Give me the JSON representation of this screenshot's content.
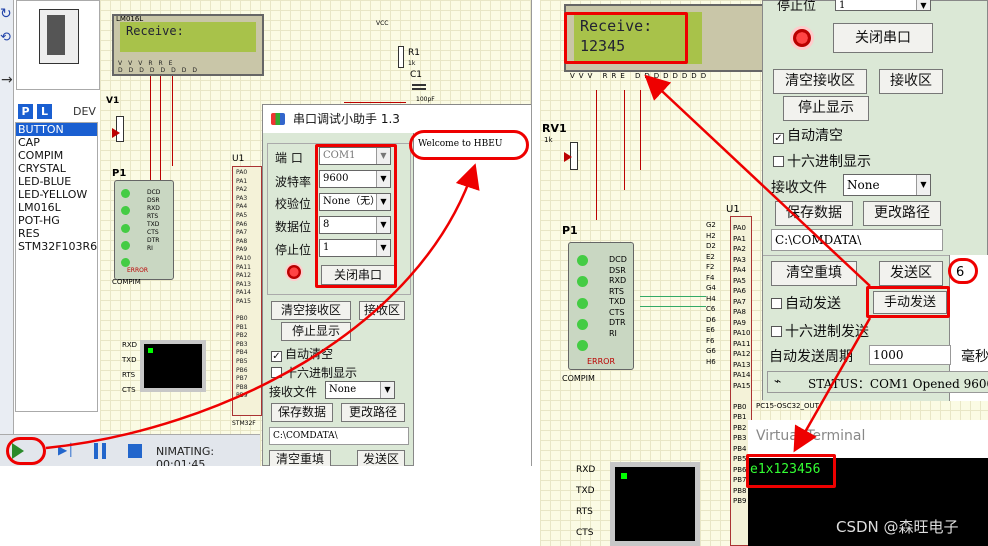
{
  "left": {
    "lcd_text": "Receive:",
    "lcd_part": "LM016L",
    "component_header": "DEV",
    "components": [
      "BUTTON",
      "CAP",
      "COMPIM",
      "CRYSTAL",
      "LED-BLUE",
      "LED-YELLOW",
      "LM016L",
      "POT-HG",
      "RES",
      "STM32F103R6"
    ],
    "selected_component": "BUTTON",
    "labels": {
      "r1": "R1",
      "r1_val": "1k",
      "c1": "C1",
      "c1_val": "100pF",
      "v1": "V1",
      "p1": "P1",
      "u1": "U1",
      "compim": "COMPIM",
      "error": "ERROR",
      "stm": "STM32F",
      "vcc": "VCC"
    },
    "db9_pins": [
      "DCD",
      "DSR",
      "RXD",
      "RTS",
      "TXD",
      "CTS",
      "DTR",
      "RI"
    ],
    "vt_pins": [
      "RXD",
      "TXD",
      "RTS",
      "CTS"
    ],
    "status": "NIMATING: 00:01:45",
    "serial_dialog": {
      "title": "串口调试小助手 1.3",
      "port_label": "端  口",
      "port_value": "COM1",
      "baud_label": "波特率",
      "baud_value": "9600",
      "parity_label": "校验位",
      "parity_value": "None（无）",
      "databits_label": "数据位",
      "databits_value": "8",
      "stopbits_label": "停止位",
      "stopbits_value": "1",
      "close_port": "关闭串口",
      "clear_recv": "清空接收区",
      "recv_area": "接收区",
      "stop_display": "停止显示",
      "auto_clear": "自动清空",
      "hex_display": "十六进制显示",
      "recv_file": "接收文件",
      "recv_file_value": "None",
      "save_data": "保存数据",
      "change_path": "更改路径",
      "path": "C:\\COMDATA\\",
      "clear_resend": "清空重填",
      "send_area": "发送区",
      "received_text": "Welcome to HBEU"
    }
  },
  "right": {
    "lcd_line1": "Receive:",
    "lcd_line2": "12345",
    "labels": {
      "rv1": "RV1",
      "rv1_val": "1k",
      "p1": "P1",
      "u1": "U1",
      "compim": "COMPIM",
      "error": "ERROR",
      "osc": "PC15-OSC32_OUT"
    },
    "pins": [
      "DCD",
      "DSR",
      "RXD",
      "RTS",
      "TXD",
      "CTS",
      "DTR",
      "RI"
    ],
    "chip_pins_left": [
      "G2",
      "H2",
      "D2",
      "E2",
      "F2",
      "F4",
      "G4",
      "H4",
      "C6",
      "D6",
      "E6",
      "F6",
      "G6",
      "H6"
    ],
    "chip_pins_right": [
      "PA0",
      "PA1",
      "PA2",
      "PA3",
      "PA4",
      "PA5",
      "PA6",
      "PA7",
      "PA8",
      "PA9",
      "PA10",
      "PA11",
      "PA12",
      "PA13",
      "PA14",
      "PA15"
    ],
    "serial_dialog": {
      "stopbits_label": "停止位",
      "stopbits_value": "1",
      "close_port": "关闭串口",
      "clear_recv": "清空接收区",
      "recv_area": "接收区",
      "stop_display": "停止显示",
      "auto_clear": "自动清空",
      "hex_display": "十六进制显示",
      "recv_file": "接收文件",
      "recv_file_value": "None",
      "save_data": "保存数据",
      "change_path": "更改路径",
      "path": "C:\\COMDATA\\",
      "clear_resend": "清空重填",
      "send_area": "发送区",
      "send_value": "6",
      "auto_send": "自动发送",
      "manual_send": "手动发送",
      "hex_send": "十六进制发送",
      "auto_period_label": "自动发送周期",
      "auto_period_value": "1000",
      "ms": "毫秒",
      "status": "STATUS：COM1 Opened 9600"
    },
    "vt_title": "Virtual Terminal",
    "vt_text": "e1x123456",
    "vt_pins": [
      "RXD",
      "TXD",
      "RTS",
      "CTS"
    ],
    "watermark": "CSDN @森旺电子"
  },
  "colors": {
    "highlight": "#e00000",
    "lcd": "#a8c24a",
    "dialog": "#dbe8d6"
  }
}
